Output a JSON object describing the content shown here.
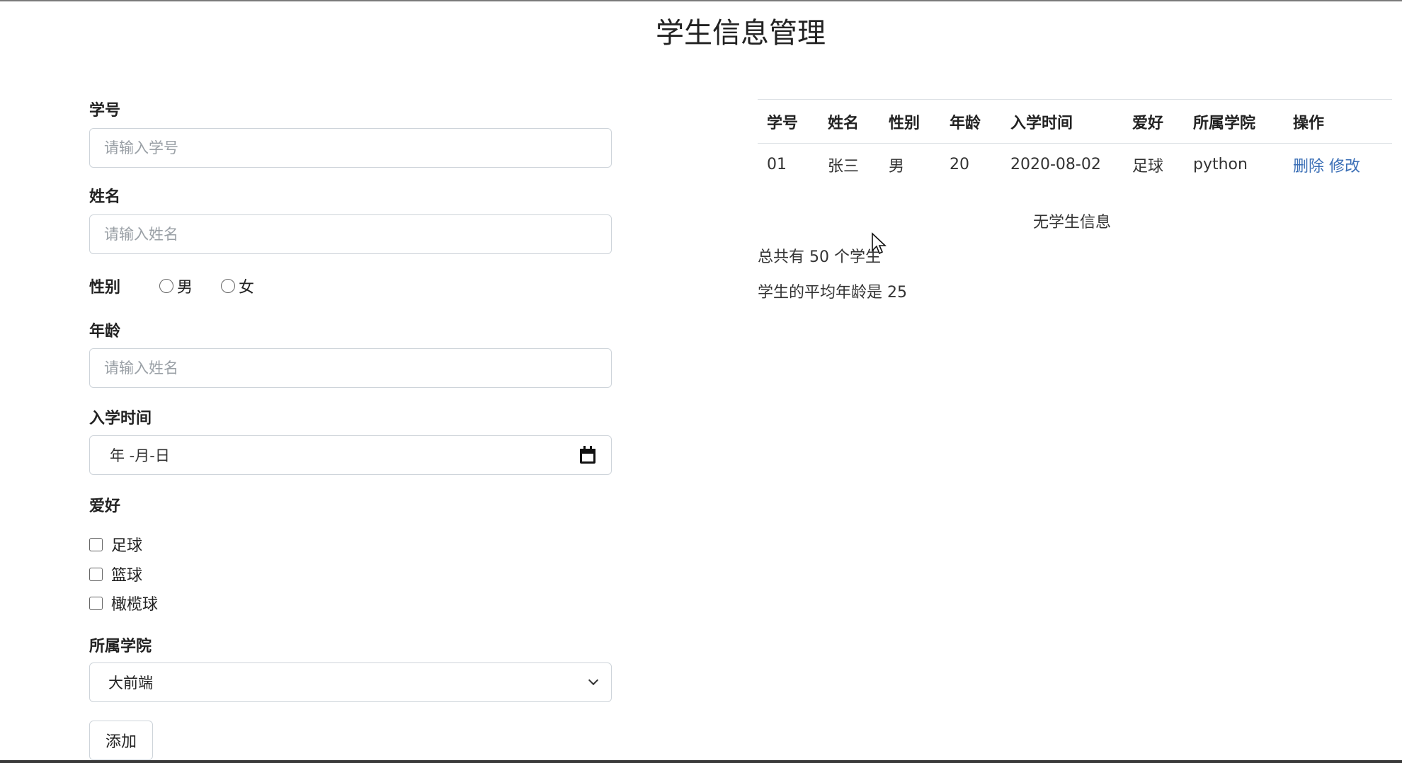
{
  "page": {
    "title": "学生信息管理"
  },
  "form": {
    "id_label": "学号",
    "id_placeholder": "请输入学号",
    "name_label": "姓名",
    "name_placeholder": "请输入姓名",
    "gender_label": "性别",
    "gender_options": [
      "男",
      "女"
    ],
    "age_label": "年龄",
    "age_placeholder": "请输入姓名",
    "date_label": "入学时间",
    "date_placeholder": "年 -月-日",
    "hobby_label": "爱好",
    "hobbies": [
      "足球",
      "篮球",
      "橄榄球"
    ],
    "college_label": "所属学院",
    "college_selected": "大前端",
    "submit_label": "添加"
  },
  "table": {
    "headers": [
      "学号",
      "姓名",
      "性别",
      "年龄",
      "入学时间",
      "爱好",
      "所属学院",
      "操作"
    ],
    "rows": [
      {
        "id": "01",
        "name": "张三",
        "gender": "男",
        "age": "20",
        "date": "2020-08-02",
        "hobby": "足球",
        "college": "python",
        "delete": "删除",
        "edit": "修改"
      }
    ],
    "empty_text": "无学生信息"
  },
  "stats": {
    "total_text": "总共有 50 个学生",
    "average_text": "学生的平均年龄是 25"
  },
  "colors": {
    "link": "#3b6fb6",
    "border": "#ced4da"
  }
}
